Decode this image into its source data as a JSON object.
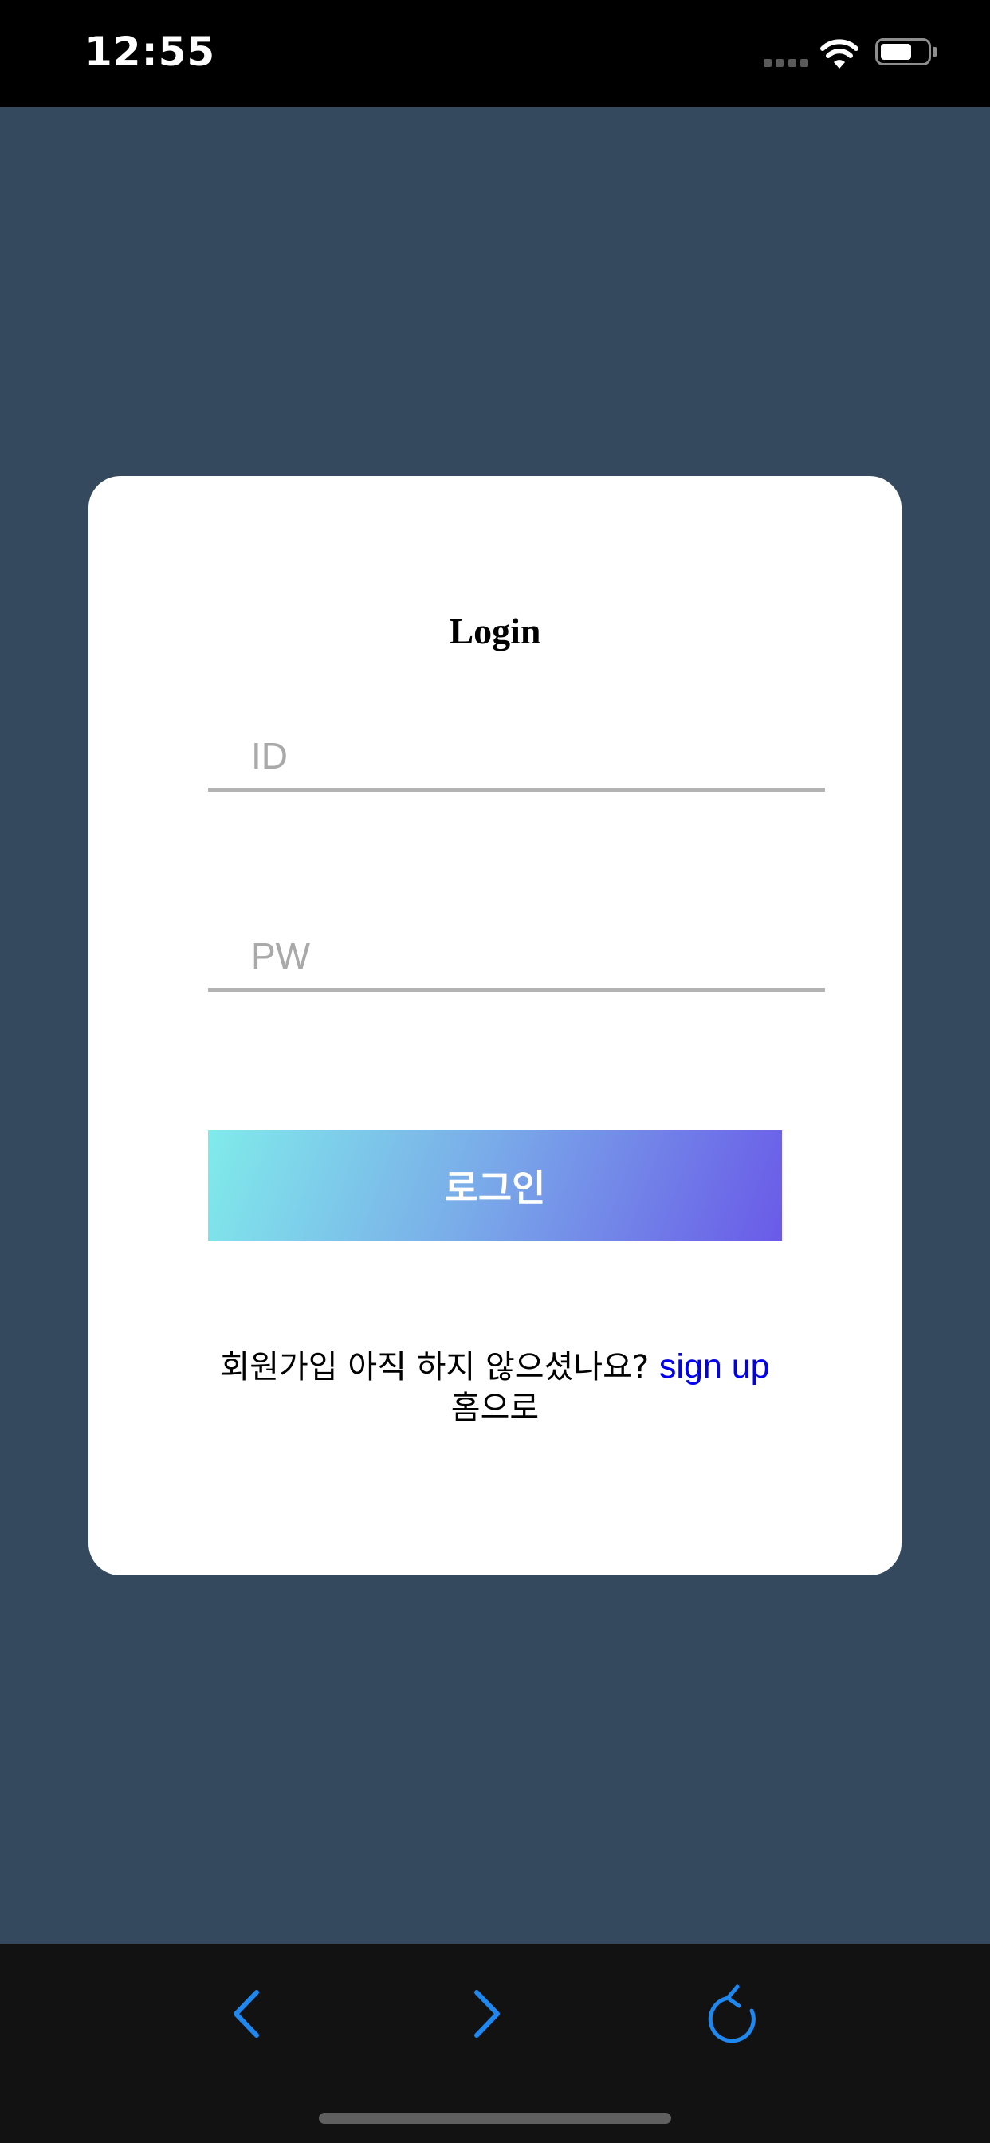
{
  "status_bar": {
    "time": "12:55",
    "icons": [
      "cellular-signal-icon",
      "wifi-icon",
      "battery-icon"
    ]
  },
  "login_card": {
    "title": "Login",
    "id_field": {
      "placeholder": "ID",
      "value": ""
    },
    "pw_field": {
      "placeholder": "PW",
      "value": ""
    },
    "login_button_label": "로그인",
    "signup_prompt": "회원가입 아직 하지 않으셨나요?",
    "signup_link": "sign up",
    "home_link": "홈으로"
  },
  "toolbar": {
    "buttons": [
      {
        "name": "back",
        "icon": "chevron-left-icon"
      },
      {
        "name": "forward",
        "icon": "chevron-right-icon"
      },
      {
        "name": "reload",
        "icon": "reload-icon"
      }
    ]
  },
  "colors": {
    "page_background": "#34495e",
    "card_background": "#ffffff",
    "button_gradient_start": "#80ebea",
    "button_gradient_end": "#6a5ae8",
    "link": "#0000ee",
    "toolbar_accent": "#1e88f0"
  }
}
